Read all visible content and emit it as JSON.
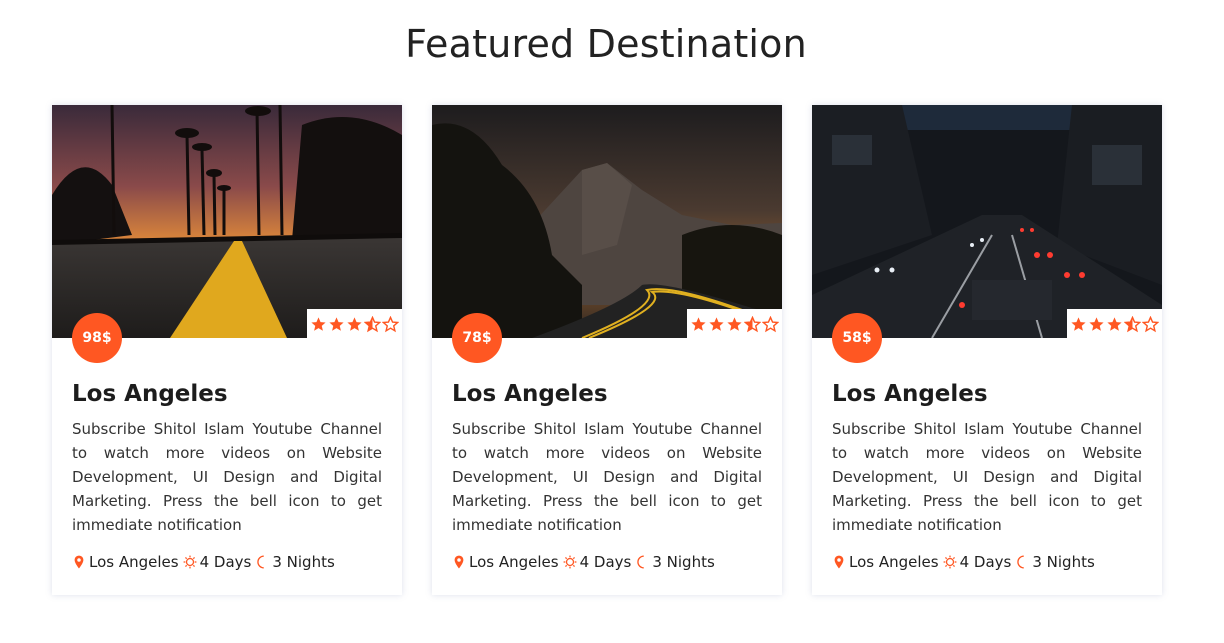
{
  "section": {
    "title": "Featured Destination"
  },
  "colors": {
    "accent": "#ff5722",
    "star": "#ff5722"
  },
  "cards": [
    {
      "image": "sunset-palm-road-photo",
      "price": "98$",
      "rating": 3.5,
      "rating_max": 5,
      "title": "Los Angeles",
      "description": "Subscribe Shitol Islam Youtube Channel to watch more videos on Website Development, UI Design and Digital Marketing. Press the bell icon to get immediate notification",
      "location": "Los Angeles",
      "days": "4 Days",
      "nights": "3 Nights"
    },
    {
      "image": "mountain-road-dusk-photo",
      "price": "78$",
      "rating": 3.5,
      "rating_max": 5,
      "title": "Los Angeles",
      "description": "Subscribe Shitol Islam Youtube Channel to watch more videos on Website Development, UI Design and Digital Marketing. Press the bell icon to get immediate notification",
      "location": "Los Angeles",
      "days": "4 Days",
      "nights": "3 Nights"
    },
    {
      "image": "city-night-traffic-photo",
      "price": "58$",
      "rating": 3.5,
      "rating_max": 5,
      "title": "Los Angeles",
      "description": "Subscribe Shitol Islam Youtube Channel to watch more videos on Website Development, UI Design and Digital Marketing. Press the bell icon to get immediate notification",
      "location": "Los Angeles",
      "days": "4 Days",
      "nights": "3 Nights"
    }
  ]
}
